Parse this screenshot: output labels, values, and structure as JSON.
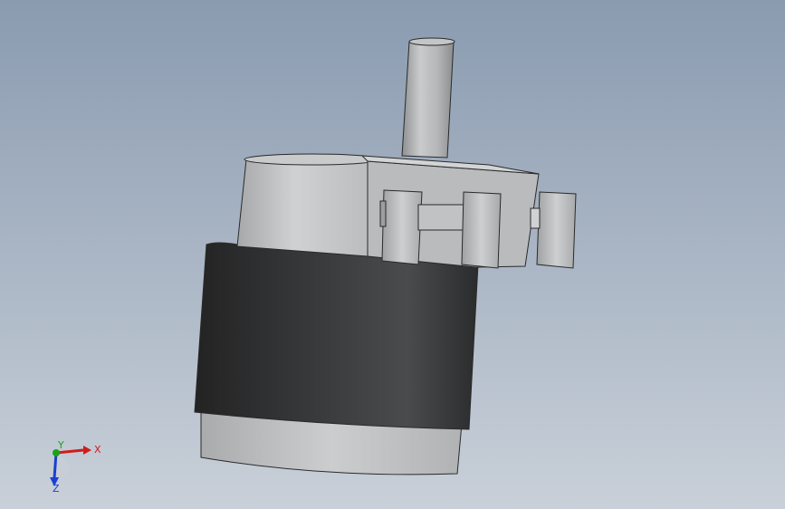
{
  "viewport": {
    "background_top": "#8a9bb0",
    "background_bottom": "#c9d0d9"
  },
  "model": {
    "name_icon": "stepper-motor-model",
    "colors": {
      "housing_light": "#c4c6c8",
      "housing_mid": "#a9abad",
      "housing_dark": "#7f8184",
      "band_dark": "#2d2d2e",
      "band_mid": "#444546",
      "edge": "#2a2a2a"
    }
  },
  "triad": {
    "x_label": "X",
    "y_label": "Y",
    "z_label": "Z",
    "colors": {
      "x": "#d01c1c",
      "y": "#1aa31a",
      "z": "#1c3fd0"
    }
  }
}
